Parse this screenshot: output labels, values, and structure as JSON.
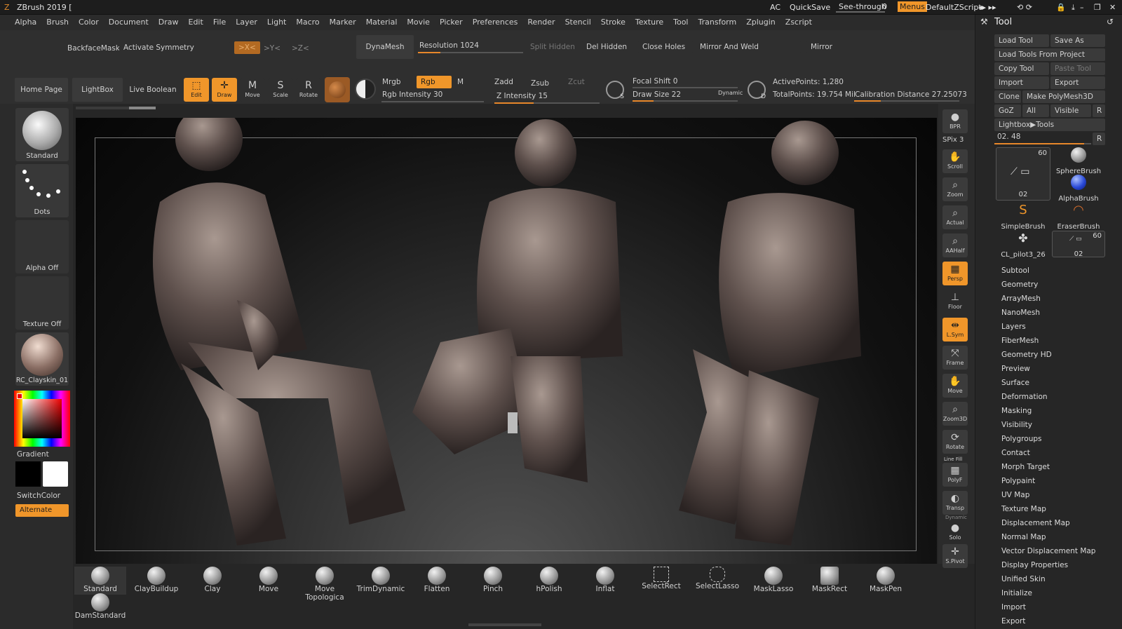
{
  "title": {
    "app": "ZBrush 2019 [",
    "ac": "AC",
    "quicksave": "QuickSave",
    "see_through": "See-through",
    "see_through_val": "0",
    "menus": "Menus",
    "script": "DefaultZScript"
  },
  "menubar": [
    "Alpha",
    "Brush",
    "Color",
    "Document",
    "Draw",
    "Edit",
    "File",
    "Layer",
    "Light",
    "Macro",
    "Marker",
    "Material",
    "Movie",
    "Picker",
    "Preferences",
    "Render",
    "Stencil",
    "Stroke",
    "Texture",
    "Tool",
    "Transform",
    "Zplugin",
    "Zscript"
  ],
  "toolbar1": {
    "backface": "BackfaceMask",
    "symmetry": "Activate Symmetry",
    "x": ">X<",
    "y": ">Y<",
    "z": ">Z<",
    "dynamesh": "DynaMesh",
    "resolution": "Resolution 1024",
    "split_hidden": "Split Hidden",
    "del_hidden": "Del Hidden",
    "close_holes": "Close Holes",
    "mirror_weld": "Mirror And Weld",
    "mirror": "Mirror"
  },
  "toolbar2": {
    "home": "Home Page",
    "lightbox": "LightBox",
    "live_boolean": "Live Boolean",
    "edit": "Edit",
    "draw": "Draw",
    "move": "Move",
    "scale": "Scale",
    "rotate": "Rotate",
    "mrgb": "Mrgb",
    "rgb": "Rgb",
    "m": "M",
    "rgb_intensity": "Rgb Intensity 30",
    "zadd": "Zadd",
    "zsub": "Zsub",
    "zcut": "Zcut",
    "z_intensity": "Z Intensity 15",
    "focal_shift": "Focal Shift 0",
    "draw_size": "Draw Size 22",
    "dynamic": "Dynamic",
    "active_points": "ActivePoints: 1,280",
    "total_points": "TotalPoints: 19.754 Mil",
    "calibration": "Calibration Distance 27.25073",
    "s_label": "S",
    "d_label": "D"
  },
  "left_shelf": {
    "standard": "Standard",
    "dots": "Dots",
    "alpha_off": "Alpha Off",
    "texture_off": "Texture Off",
    "material": "RC_Clayskin_01",
    "gradient": "Gradient",
    "switchcolor": "SwitchColor",
    "alternate": "Alternate"
  },
  "right_shelf": [
    "BPR",
    "SPix 3",
    "Scroll",
    "Zoom",
    "Actual",
    "AAHalf",
    "Persp",
    "Floor",
    "L.Sym",
    "Frame",
    "Move",
    "Zoom3D",
    "Rotate",
    "Line Fill",
    "PolyF",
    "Transp",
    "Dynamic",
    "Solo",
    "S.Pivot"
  ],
  "tool_panel": {
    "title": "Tool",
    "load_tool": "Load Tool",
    "save_as": "Save As",
    "load_from_project": "Load Tools From Project",
    "copy_tool": "Copy Tool",
    "paste_tool": "Paste Tool",
    "import": "Import",
    "export": "Export",
    "clone": "Clone",
    "make_polymesh": "Make PolyMesh3D",
    "goz": "GoZ",
    "all": "All",
    "visible": "Visible",
    "r": "R",
    "lightbox_tools": "Lightbox▶Tools",
    "current_tool": "02. 48",
    "tiles": [
      {
        "label": "02",
        "count": "60"
      },
      {
        "label": "SphereBrush"
      },
      {
        "label": "AlphaBrush"
      },
      {
        "label": "SimpleBrush"
      },
      {
        "label": "EraserBrush"
      },
      {
        "label": "CL_pilot3_26"
      },
      {
        "label": "02",
        "count": "60"
      }
    ],
    "sections": [
      "Subtool",
      "Geometry",
      "ArrayMesh",
      "NanoMesh",
      "Layers",
      "FiberMesh",
      "Geometry HD",
      "Preview",
      "Surface",
      "Deformation",
      "Masking",
      "Visibility",
      "Polygroups",
      "Contact",
      "Morph Target",
      "Polypaint",
      "UV Map",
      "Texture Map",
      "Displacement Map",
      "Normal Map",
      "Vector Displacement Map",
      "Display Properties",
      "Unified Skin",
      "Initialize",
      "Import",
      "Export"
    ]
  },
  "brushes": [
    "Standard",
    "ClayBuildup",
    "Clay",
    "Move",
    "Move Topologica",
    "TrimDynamic",
    "Flatten",
    "Pinch",
    "hPolish",
    "Inflat",
    "SelectRect",
    "SelectLasso",
    "MaskLasso",
    "MaskRect",
    "MaskPen"
  ],
  "brush_row2": "DamStandard",
  "colors": {
    "accent": "#f0962a",
    "panel": "#2b2b2b",
    "viewport": "#1a1a1a"
  }
}
